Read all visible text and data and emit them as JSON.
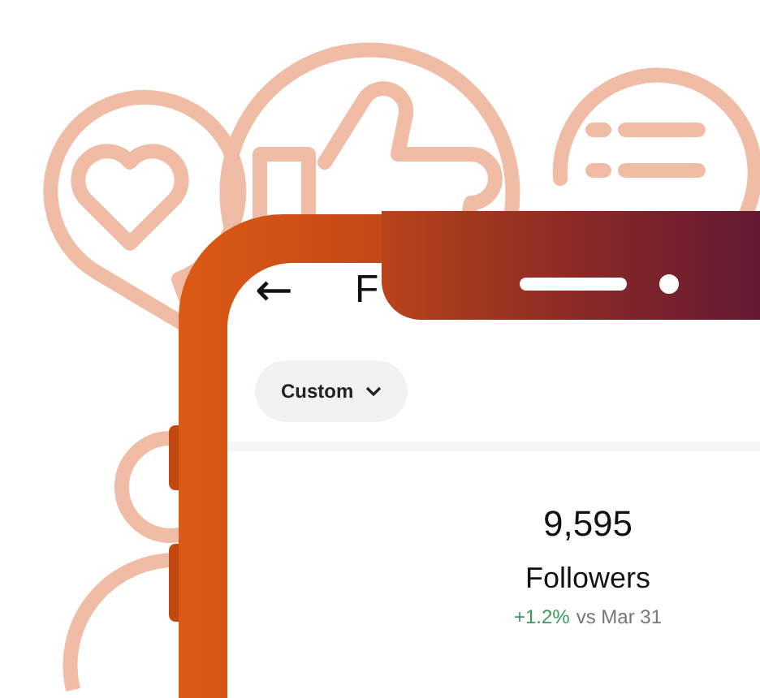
{
  "header": {
    "back_icon": "←",
    "title": "F"
  },
  "filter": {
    "label": "Custom"
  },
  "stat": {
    "value": "9,595",
    "label": "Followers",
    "change": "+1.2%",
    "comparison": "vs Mar 31"
  }
}
